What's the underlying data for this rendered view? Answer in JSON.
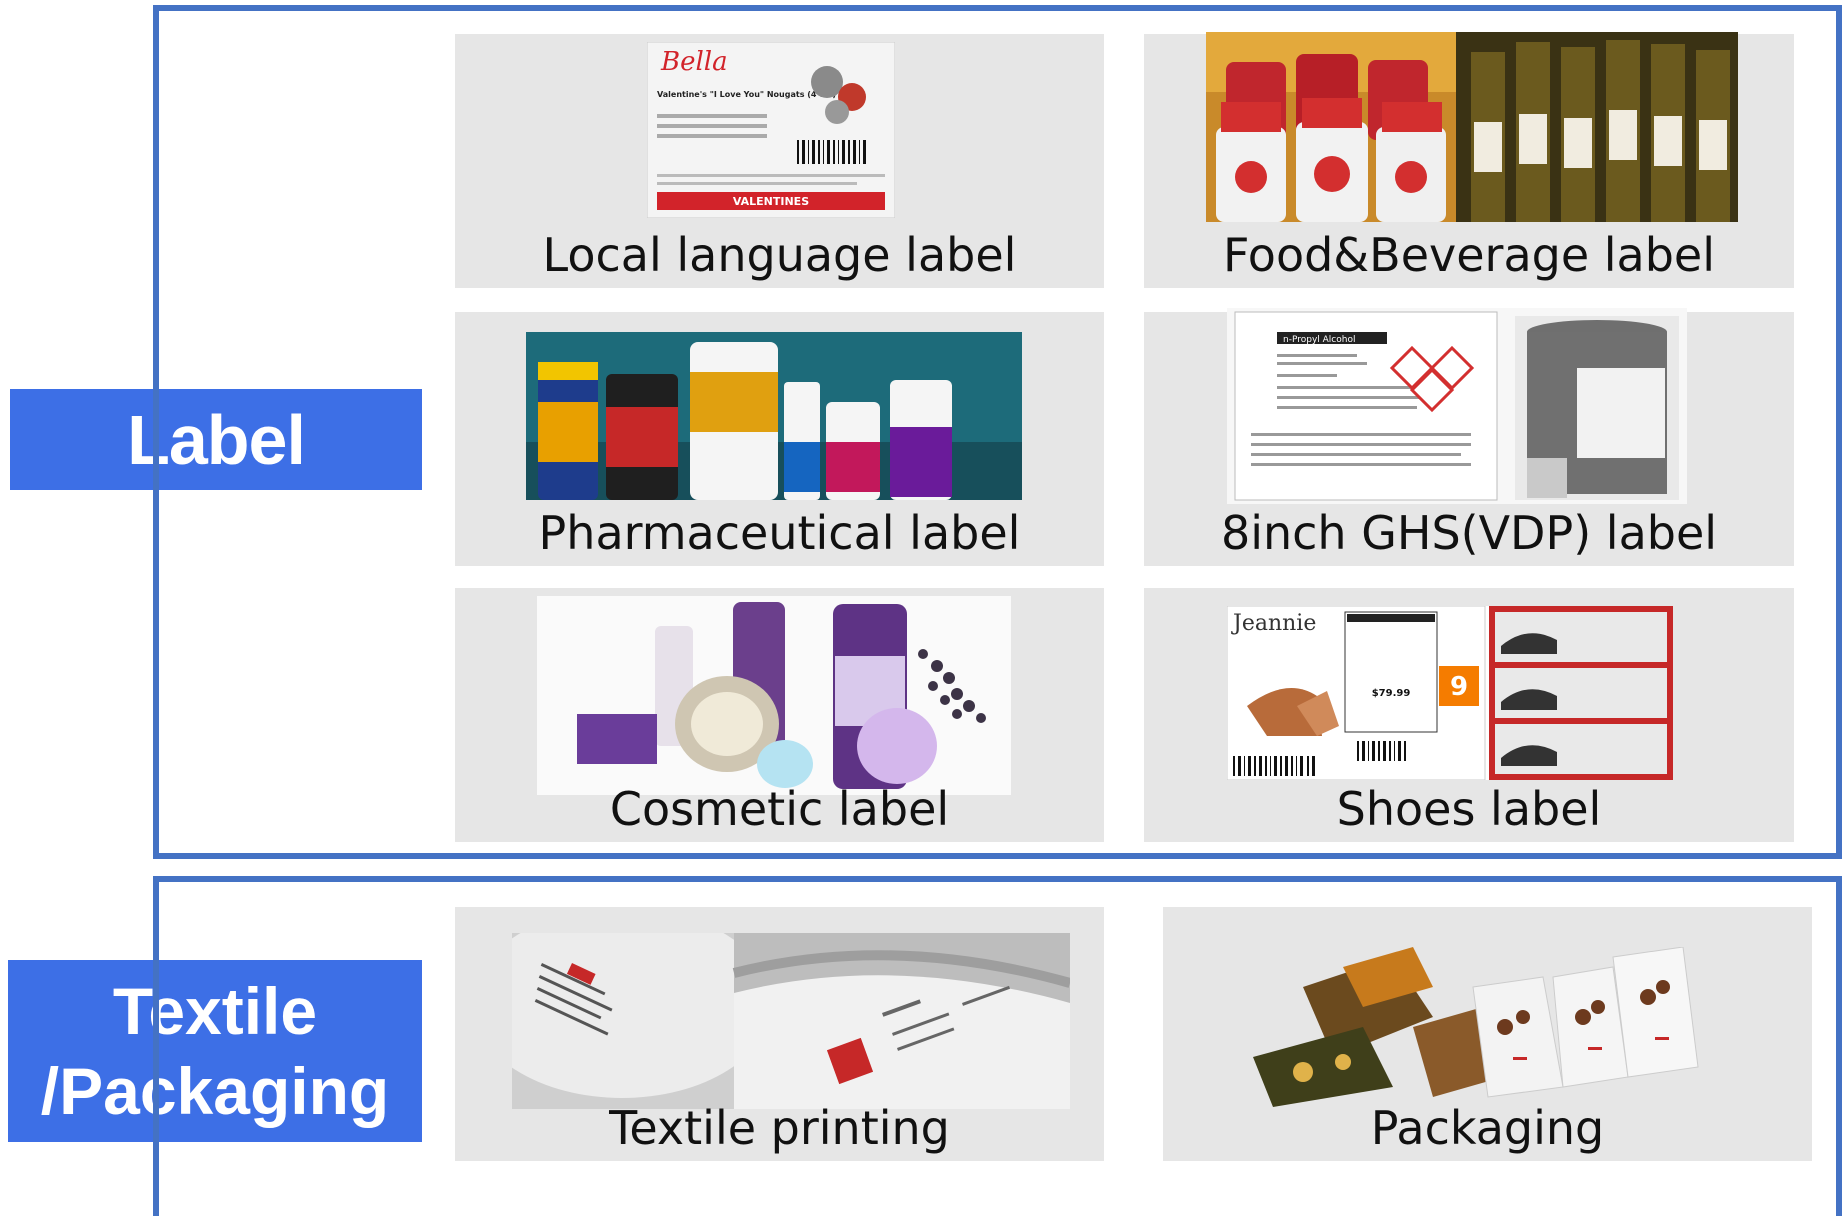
{
  "categories": {
    "label": "Label",
    "textile_line1": "Textile",
    "textile_line2": "/Packaging"
  },
  "tiles": [
    {
      "caption": "Local language label",
      "image": "valentines-label-image"
    },
    {
      "caption": "Food&Beverage label",
      "image": "food-beverage-jars-bottles-image"
    },
    {
      "caption": "Pharmaceutical label",
      "image": "pharmaceutical-bottles-image"
    },
    {
      "caption": "8inch GHS(VDP) label",
      "image": "ghs-chemical-label-image"
    },
    {
      "caption": "Cosmetic label",
      "image": "cosmetic-products-image"
    },
    {
      "caption": "Shoes label",
      "image": "shoes-label-image"
    },
    {
      "caption": "Textile printing",
      "image": "textile-printed-tags-image"
    },
    {
      "caption": "Packaging",
      "image": "packaging-pouches-image"
    }
  ],
  "image_text": {
    "brand": "Bella",
    "product": "Valentine's \"I Love You\" Nougats (4 oz.)",
    "banner": "VALENTINES",
    "ghs_title": "n-Propyl Alcohol",
    "shoe_brand": "Jeannie",
    "shoe_price": "$79.99",
    "shoe_size": "9"
  },
  "colors": {
    "accent_blue": "#3d6fe6",
    "frame_blue": "#4472c4",
    "tile_gray": "#e6e6e6"
  }
}
